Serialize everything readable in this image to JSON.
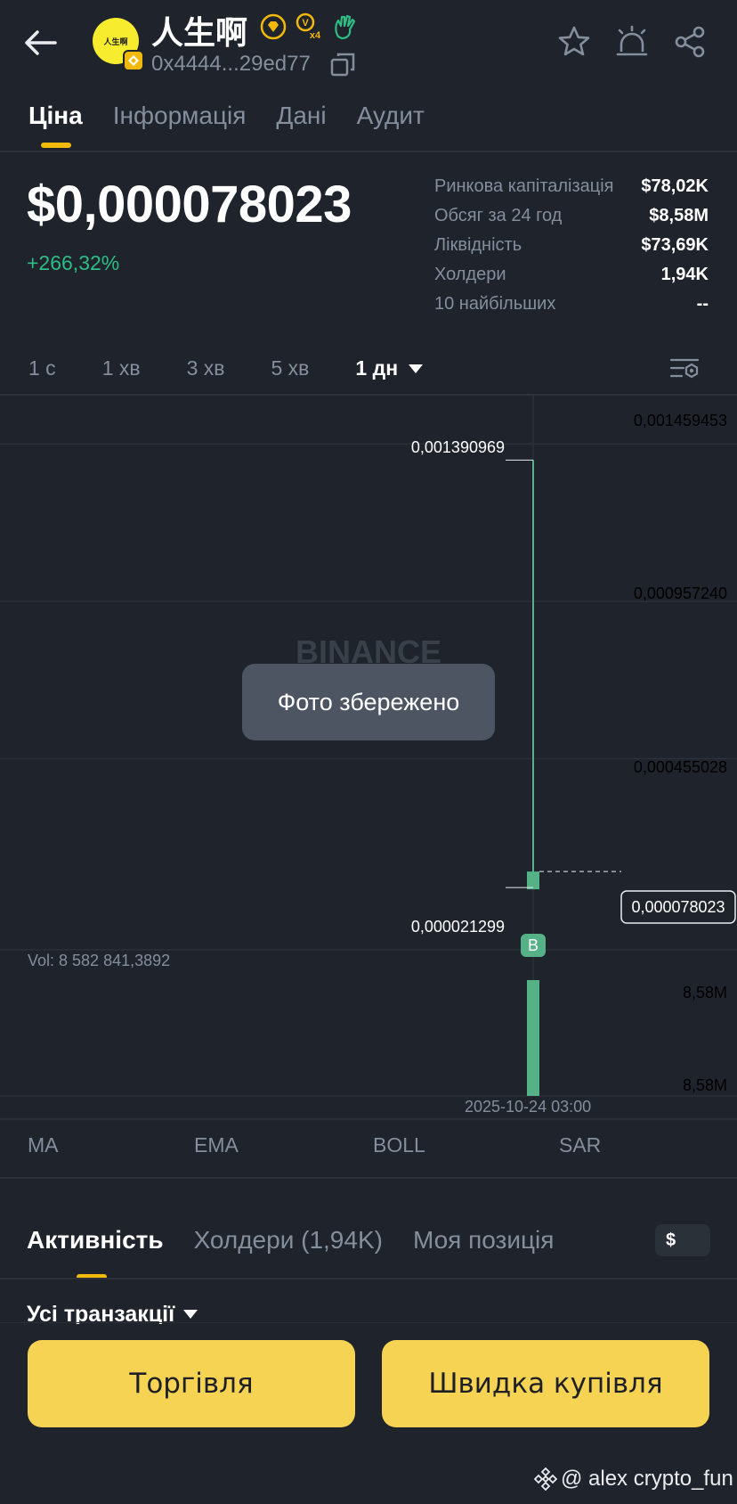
{
  "header": {
    "token_name": "人生啊",
    "logo_text": "人生啊",
    "address": "0x4444...29ed77",
    "badge_vx": "V",
    "badge_x4": "x4"
  },
  "tabs": [
    {
      "label": "Ціна",
      "active": true
    },
    {
      "label": "Інформація"
    },
    {
      "label": "Дані"
    },
    {
      "label": "Аудит"
    }
  ],
  "price": {
    "value": "$0,000078023",
    "change": "+266,32%"
  },
  "stats": [
    {
      "label": "Ринкова капіталізація",
      "value": "$78,02K"
    },
    {
      "label": "Обсяг за 24 год",
      "value": "$8,58M"
    },
    {
      "label": "Ліквідність",
      "value": "$73,69K"
    },
    {
      "label": "Холдери",
      "value": "1,94K"
    },
    {
      "label": "10 найбільших",
      "value": "--"
    }
  ],
  "intervals": [
    "1 с",
    "1 хв",
    "3 хв",
    "5 хв",
    "1 дн"
  ],
  "chart_data": {
    "type": "candlestick",
    "watermark": "BINANCE",
    "y_axis_ticks": [
      "0,001459453",
      "0,000957240",
      "0,000455028"
    ],
    "current_price_label": "0,000078023",
    "high_label": "0,001390969",
    "low_label": "0,000021299",
    "candle": {
      "open": 2.1299e-05,
      "high": 0.001390969,
      "low": 2.1299e-05,
      "close": 7.8023e-05
    },
    "ylim": [
      -4.66e-05,
      0.0015
    ],
    "trade_marker": "B",
    "volume_label": "Vol: 8 582 841,3892",
    "volume_ticks": [
      "8,58M",
      "8,58M"
    ],
    "volume_value": 8582841.3892,
    "x_label": "2025-10-24 03:00",
    "colors": {
      "up": "#55b287",
      "bg": "#1f232b",
      "grid": "#2b3139"
    }
  },
  "toast": "Фото збережено",
  "indicators": [
    "MA",
    "EMA",
    "BOLL",
    "SAR"
  ],
  "activity_tabs": [
    {
      "label": "Активність",
      "active": true
    },
    {
      "label": "Холдери (1,94K)"
    },
    {
      "label": "Моя позиція"
    }
  ],
  "currency_toggle": "$",
  "all_transactions": "Усі транзакції",
  "buttons": {
    "trade": "Торгівля",
    "quick_buy": "Швидка купівля"
  },
  "watermark_text": "@ alex crypto_fun",
  "colors": {
    "accent": "#f0b90b",
    "positive": "#2ebd85",
    "button": "#f6d353"
  }
}
